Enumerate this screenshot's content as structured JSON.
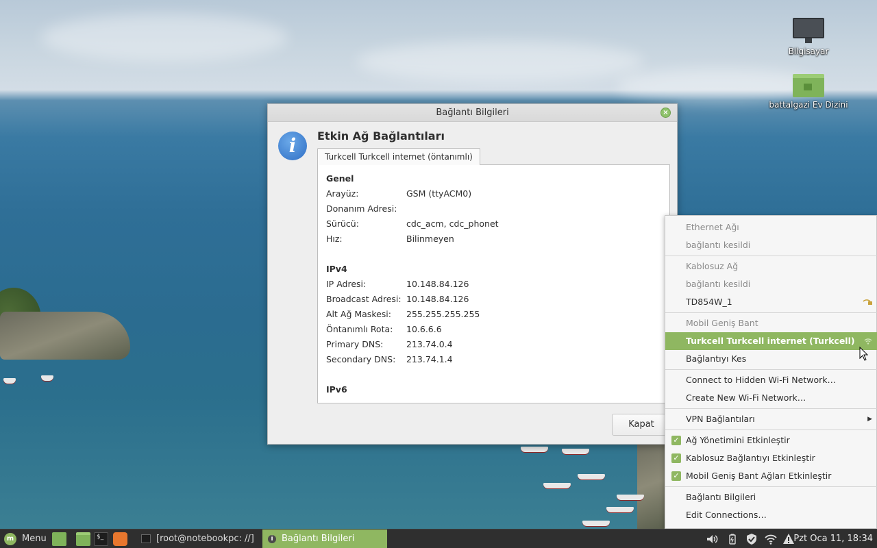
{
  "desktop": {
    "icons": [
      {
        "label": "Bilgisayar",
        "icon": "computer-icon"
      },
      {
        "label": "battalgazi Ev Dizini",
        "icon": "home-folder-icon"
      }
    ]
  },
  "dialog": {
    "title": "Bağlantı Bilgileri",
    "heading": "Etkin Ağ Bağlantıları",
    "tab": "Turkcell Turkcell internet (öntanımlı)",
    "sections": [
      {
        "title": "Genel",
        "rows": [
          {
            "label": "Arayüz:",
            "value": "GSM (ttyACM0)"
          },
          {
            "label": "Donanım Adresi:",
            "value": ""
          },
          {
            "label": "Sürücü:",
            "value": "cdc_acm, cdc_phonet"
          },
          {
            "label": "Hız:",
            "value": "Bilinmeyen"
          }
        ]
      },
      {
        "title": "IPv4",
        "rows": [
          {
            "label": "IP Adresi:",
            "value": "10.148.84.126"
          },
          {
            "label": "Broadcast Adresi:",
            "value": "10.148.84.126"
          },
          {
            "label": "Alt Ağ Maskesi:",
            "value": "255.255.255.255"
          },
          {
            "label": "Öntanımlı Rota:",
            "value": "10.6.6.6"
          },
          {
            "label": "Primary DNS:",
            "value": "213.74.0.4"
          },
          {
            "label": "Secondary DNS:",
            "value": "213.74.1.4"
          }
        ]
      },
      {
        "title": "IPv6",
        "rows": []
      }
    ],
    "close_button": "Kapat"
  },
  "network_menu": {
    "ethernet_header": "Ethernet Ağı",
    "ethernet_status": "bağlantı kesildi",
    "wireless_header": "Kablosuz Ağ",
    "wireless_status": "bağlantı kesildi",
    "wifi_network": "TD854W_1",
    "mobile_header": "Mobil Geniş Bant",
    "mobile_active": "Turkcell Turkcell internet (Turkcell)",
    "disconnect": "Bağlantıyı Kes",
    "connect_hidden": "Connect to Hidden Wi-Fi Network…",
    "create_wifi": "Create New Wi-Fi Network…",
    "vpn": "VPN Bağlantıları",
    "toggles": [
      {
        "label": "Ağ Yönetimini Etkinleştir",
        "checked": true
      },
      {
        "label": "Kablosuz Bağlantıyı Etkinleştir",
        "checked": true
      },
      {
        "label": "Mobil Geniş Bant Ağları Etkinleştir",
        "checked": true
      }
    ],
    "connection_info": "Bağlantı Bilgileri",
    "edit_connections": "Edit Connections…"
  },
  "taskbar": {
    "menu_label": "Menu",
    "windows": [
      {
        "label": "[root@notebookpc: //]",
        "active": false
      },
      {
        "label": "Bağlantı Bilgileri",
        "active": true
      }
    ],
    "clock": "Pzt Oca 11, 18:34"
  },
  "colors": {
    "accent": "#8fb761",
    "taskbar": "#2f2f2f"
  }
}
